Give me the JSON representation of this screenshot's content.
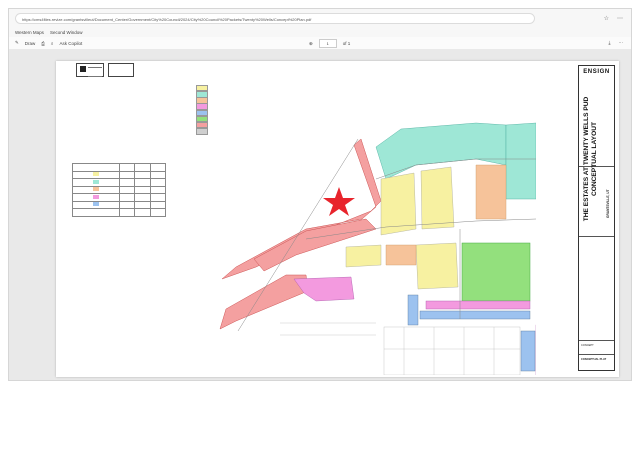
{
  "browser": {
    "url": "https://cms4files.revize.com/grantsvilleut/Document_Center/Government/City%20Council/2024/City%20Council%20Packets/Twenty%20Wells/Concept%20Plan.pdf",
    "bookmarks": [
      "Western Maps",
      "Second Window"
    ]
  },
  "pdf_toolbar": {
    "draw_label": "Draw",
    "ask_copilot": "Ask Copilot",
    "page_current": "1",
    "page_total": "of 1"
  },
  "colors": {
    "legend_yellow": "#f7f1a1",
    "legend_aqua": "#9ee7d6",
    "legend_orange": "#f6c39a",
    "legend_pink": "#f39adf",
    "legend_blue": "#9cc2ef",
    "legend_green": "#93e07d",
    "legend_salmon": "#f4a0a0",
    "legend_gray": "#cfcfcf",
    "star": "#e8242c"
  },
  "title_block": {
    "firm": "ENSIGN",
    "project_title_1": "THE ESTATES AT TWENTY WELLS PUD",
    "project_title_2": "CONCEPTUAL LAYOUT",
    "location": "GRANTSVILLE, UT",
    "concept": "CONCEPT",
    "sheet_label": "CONCEPTUAL PLAT"
  },
  "icons": [
    "refresh-icon",
    "star-icon",
    "menu-icon",
    "draw-icon",
    "print-icon",
    "search-icon",
    "zoom-icon",
    "save-icon",
    "red-star-marker"
  ]
}
